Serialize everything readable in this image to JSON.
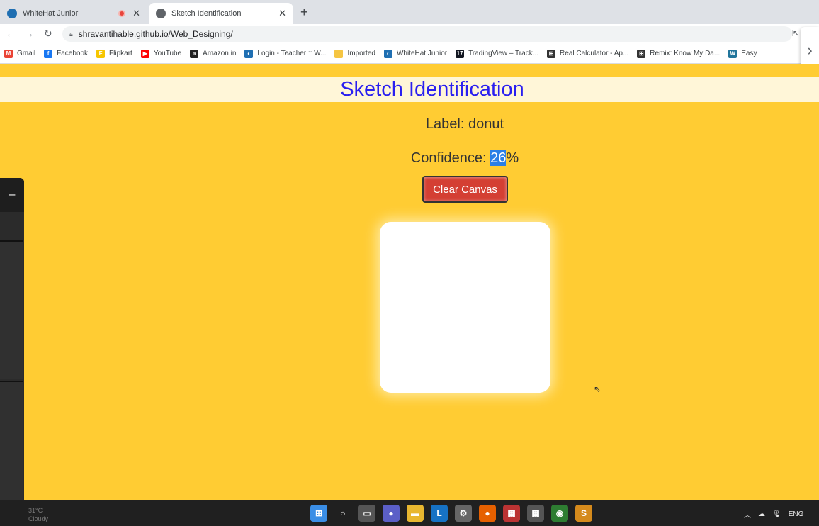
{
  "browser": {
    "tabs": [
      {
        "title": "WhiteHat Junior",
        "icon": "whitehat-icon",
        "recording": true
      },
      {
        "title": "Sketch Identification",
        "icon": "globe-icon",
        "active": true
      }
    ],
    "url": "shravantihable.github.io/Web_Designing/",
    "bookmarks": [
      {
        "label": "Gmail",
        "icon": "gmail-icon",
        "color": "#ea4335",
        "glyph": "M"
      },
      {
        "label": "Facebook",
        "icon": "facebook-icon",
        "color": "#1877f2",
        "glyph": "f"
      },
      {
        "label": "Flipkart",
        "icon": "flipkart-icon",
        "color": "#f7c600",
        "glyph": "F"
      },
      {
        "label": "YouTube",
        "icon": "youtube-icon",
        "color": "#ff0000",
        "glyph": "▶"
      },
      {
        "label": "Amazon.in",
        "icon": "amazon-icon",
        "color": "#222222",
        "glyph": "a"
      },
      {
        "label": "Login - Teacher :: W...",
        "icon": "whitehat-icon",
        "color": "#1f6fb2",
        "glyph": "◐"
      },
      {
        "label": "Imported",
        "icon": "folder-icon",
        "color": "#f5c542",
        "glyph": ""
      },
      {
        "label": "WhiteHat Junior",
        "icon": "whitehat-icon",
        "color": "#1f6fb2",
        "glyph": "◐"
      },
      {
        "label": "TradingView – Track...",
        "icon": "tradingview-icon",
        "color": "#131722",
        "glyph": "17"
      },
      {
        "label": "Real Calculator - Ap...",
        "icon": "calculator-icon",
        "color": "#333333",
        "glyph": "⊞"
      },
      {
        "label": "Remix: Know My Da...",
        "icon": "remix-icon",
        "color": "#333333",
        "glyph": "⊞"
      },
      {
        "label": "Easy",
        "icon": "wordpress-icon",
        "color": "#21759b",
        "glyph": "W"
      }
    ]
  },
  "page": {
    "heading": "Sketch Identification",
    "label_prefix": "Label: ",
    "label_value": "donut",
    "confidence_prefix": "Confidence: ",
    "confidence_value": "26",
    "confidence_suffix": "%",
    "clear_button": "Clear Canvas"
  },
  "colors": {
    "page_background": "#ffcc33",
    "heading": "#2a1ff0",
    "clear_button": "#d43f33"
  },
  "taskbar": {
    "weather_temp": "31°C",
    "weather_desc": "Cloudy",
    "language": "ENG",
    "apps": [
      {
        "name": "windows-start-icon",
        "color": "#3a8ee6",
        "glyph": "⊞"
      },
      {
        "name": "search-icon",
        "color": "#202020",
        "glyph": "○"
      },
      {
        "name": "task-view-icon",
        "color": "#555555",
        "glyph": "▭"
      },
      {
        "name": "teams-chat-icon",
        "color": "#5b5fc7",
        "glyph": "●"
      },
      {
        "name": "file-explorer-icon",
        "color": "#e8b730",
        "glyph": "▬"
      },
      {
        "name": "lync-icon",
        "color": "#1672c4",
        "glyph": "L"
      },
      {
        "name": "settings-icon",
        "color": "#666666",
        "glyph": "⚙"
      },
      {
        "name": "firefox-icon",
        "color": "#e66000",
        "glyph": "●"
      },
      {
        "name": "notepad-icon",
        "color": "#b33",
        "glyph": "▦"
      },
      {
        "name": "calculator-icon",
        "color": "#555555",
        "glyph": "▦"
      },
      {
        "name": "chrome-icon",
        "color": "#2e7d32",
        "glyph": "◉"
      },
      {
        "name": "sublime-icon",
        "color": "#d58a1c",
        "glyph": "S"
      }
    ]
  }
}
